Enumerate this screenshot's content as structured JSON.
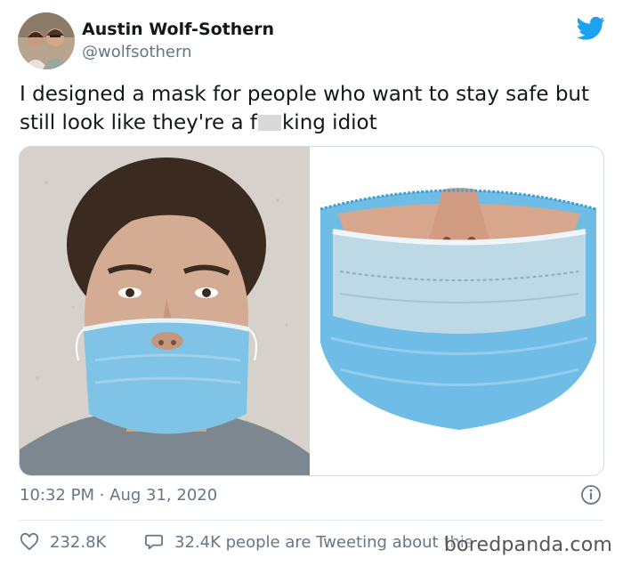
{
  "author": {
    "name": "Austin Wolf-Sothern",
    "handle": "@wolfsothern"
  },
  "tweet": {
    "text_part1": "I designed a mask for people who want to stay safe but still look like they're a f",
    "text_part2": "king idiot"
  },
  "meta": {
    "timestamp": "10:32 PM · Aug 31, 2020"
  },
  "actions": {
    "likes": "232.8K",
    "replies": "32.4K people are Tweeting about this"
  },
  "watermark": "boredpanda.com",
  "colors": {
    "twitter_blue": "#1da1f2",
    "secondary_text": "#657786",
    "mask_blue": "#7fc4e6"
  },
  "icons": {
    "brand": "twitter-bird-icon",
    "info": "info-icon",
    "like": "heart-icon",
    "reply": "speech-bubble-icon"
  }
}
